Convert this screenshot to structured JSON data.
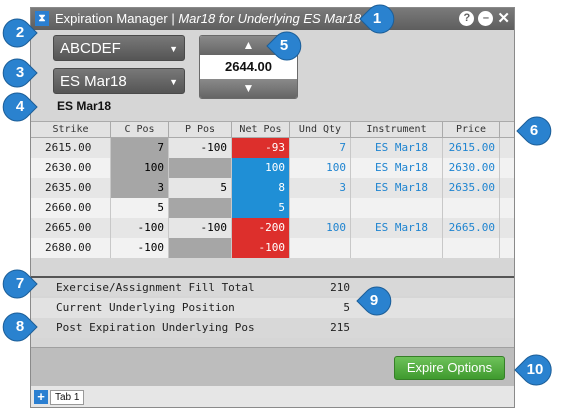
{
  "window": {
    "title_main": "Expiration Manager",
    "title_sep": " | ",
    "title_detail": "Mar18 for Underlying ES Mar18",
    "logo_glyph": "⧗",
    "icons": [
      "help-icon",
      "minimize-icon",
      "close-icon"
    ],
    "help_glyph": "?",
    "min_glyph": "–",
    "close_glyph": "✕"
  },
  "controls": {
    "account_value": "ABCDEF",
    "underlying_value": "ES Mar18",
    "dropdown_arrow": "▼",
    "price_value": "2644.00",
    "up_glyph": "▲",
    "down_glyph": "▼"
  },
  "underlying_label": "ES Mar18",
  "table": {
    "columns": [
      "Strike",
      "C Pos",
      "P Pos",
      "Net Pos",
      "Und Qty",
      "Instrument",
      "Price"
    ],
    "rows": [
      {
        "strike": "2615.00",
        "cpos": "7",
        "ppos": "-100",
        "net": "-93",
        "und": "7",
        "inst": "ES Mar18",
        "price": "2615.00",
        "net_sign": "neg"
      },
      {
        "strike": "2630.00",
        "cpos": "100",
        "ppos": "",
        "net": "100",
        "und": "100",
        "inst": "ES Mar18",
        "price": "2630.00",
        "net_sign": "pos"
      },
      {
        "strike": "2635.00",
        "cpos": "3",
        "ppos": "5",
        "net": "8",
        "und": "3",
        "inst": "ES Mar18",
        "price": "2635.00",
        "net_sign": "pos"
      },
      {
        "strike": "2660.00",
        "cpos": "5",
        "ppos": "",
        "net": "5",
        "und": "",
        "inst": "",
        "price": "",
        "net_sign": "pos"
      },
      {
        "strike": "2665.00",
        "cpos": "-100",
        "ppos": "-100",
        "net": "-200",
        "und": "100",
        "inst": "ES Mar18",
        "price": "2665.00",
        "net_sign": "neg"
      },
      {
        "strike": "2680.00",
        "cpos": "-100",
        "ppos": "",
        "net": "-100",
        "und": "",
        "inst": "",
        "price": "",
        "net_sign": "neg"
      }
    ]
  },
  "summary": {
    "fill_total_label": "Exercise/Assignment Fill Total",
    "fill_total_value": "210",
    "current_pos_label": "Current Underlying Position",
    "current_pos_value": "5",
    "post_exp_label": "Post Expiration Underlying Pos",
    "post_exp_value": "215"
  },
  "footer": {
    "expire_label": "Expire Options"
  },
  "tabs": {
    "add_glyph": "+",
    "tab1_label": "Tab 1"
  },
  "callouts": [
    "1",
    "2",
    "3",
    "4",
    "5",
    "6",
    "7",
    "8",
    "9",
    "10"
  ],
  "colors": {
    "callout_blue": "#2a82cf",
    "negative_red": "#dd2f2c",
    "positive_blue": "#1f8fd6",
    "link_blue": "#1f84d0",
    "expire_green": "#4eaa3b"
  }
}
